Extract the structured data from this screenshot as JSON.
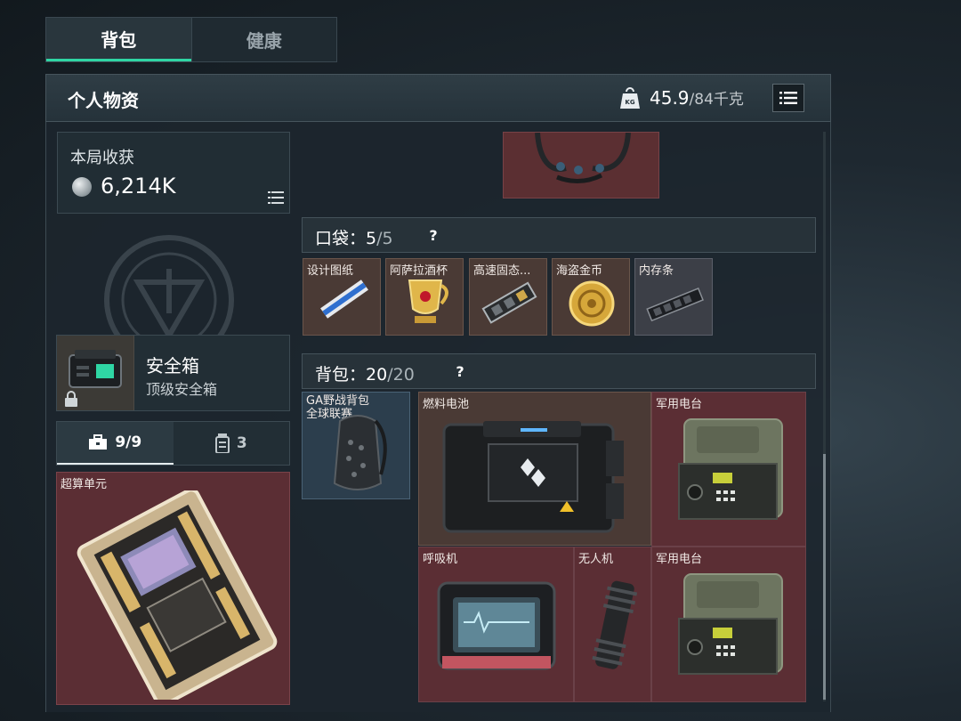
{
  "tabs": [
    {
      "label": "背包",
      "active": true
    },
    {
      "label": "健康",
      "active": false
    }
  ],
  "header": {
    "title": "个人物资",
    "weight_current": "45.9",
    "weight_capacity": "/84千克",
    "weight_icon": "kg-weight-icon",
    "menu_icon": "list-menu-icon"
  },
  "loot": {
    "title": "本局收获",
    "value": "6,214K",
    "coin_icon": "coin-icon"
  },
  "safe_box": {
    "name": "安全箱",
    "subtitle": "顶级安全箱",
    "lock_icon": "lock-icon"
  },
  "capacity_tabs": [
    {
      "icon": "briefcase-icon",
      "label": "9/9",
      "active": true
    },
    {
      "icon": "canister-icon",
      "label": "3",
      "active": false
    }
  ],
  "safe_item": {
    "name": "超算单元"
  },
  "pockets": {
    "label": "口袋：",
    "count": "5",
    "capacity": "/5",
    "help": "?",
    "items": [
      "设计图纸",
      "阿萨拉酒杯",
      "高速固态...",
      "海盗金币",
      "内存条"
    ]
  },
  "backpack": {
    "label": "背包：",
    "count": "20",
    "capacity": "/20",
    "help": "?",
    "bag_name": "GA野战背包",
    "bag_sub": "全球联赛",
    "items": [
      "燃料电池",
      "军用电台",
      "呼吸机",
      "无人机",
      "军用电台"
    ]
  },
  "colors": {
    "accent": "#2fd6a4",
    "red_rarity": "#5b2e34",
    "gold_rarity": "#4a3a35",
    "purple_rarity": "#3c3f47",
    "blue_rarity": "#2c3e4d"
  }
}
